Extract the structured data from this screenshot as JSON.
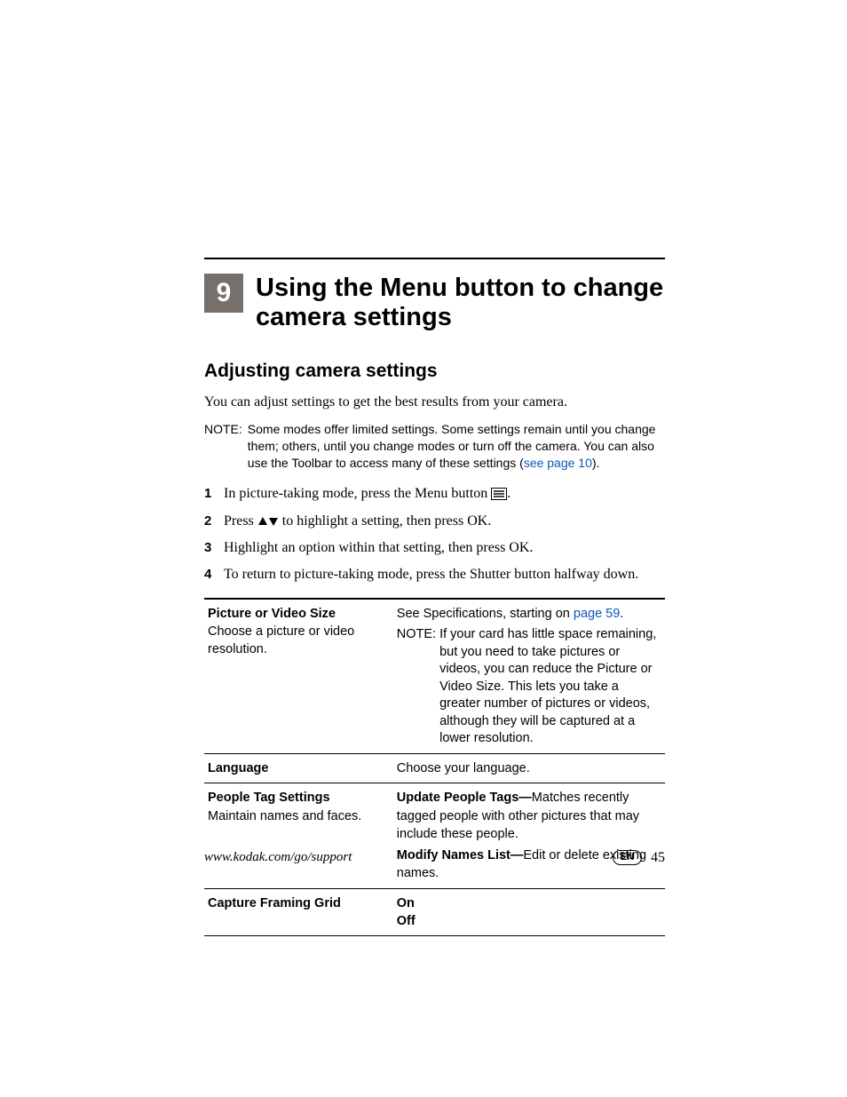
{
  "chapter": {
    "number": "9",
    "title": "Using the Menu button to change camera settings"
  },
  "section": {
    "title": "Adjusting camera settings",
    "intro": "You can adjust settings to get the best results from your camera."
  },
  "note": {
    "label": "NOTE:",
    "body_pre": "Some modes offer limited settings. Some settings remain until you change them; others, until you change modes or turn off the camera. You can also use the Toolbar to access many of these settings (",
    "link": "see page 10",
    "body_post": ")."
  },
  "steps": [
    {
      "num": "1",
      "pre": "In picture-taking mode, press the Menu button ",
      "icon": "menu",
      "post": "."
    },
    {
      "num": "2",
      "pre": "Press ",
      "icon": "updown",
      "post": " to highlight a setting, then press OK."
    },
    {
      "num": "3",
      "pre": "Highlight an option within that setting, then press OK.",
      "icon": "",
      "post": ""
    },
    {
      "num": "4",
      "pre": "To return to picture-taking mode, press the Shutter button halfway down.",
      "icon": "",
      "post": ""
    }
  ],
  "table": {
    "rows": [
      {
        "left_head": "Picture or Video Size",
        "left_sub": "Choose a picture or video resolution.",
        "right_pre": "See Specifications, starting on ",
        "right_link": "page 59",
        "right_post": ".",
        "right_note_label": "NOTE:",
        "right_note": "If your card has little space remaining, but you need to take pictures or videos, you can reduce the Picture or Video Size. This lets you take a greater number of pictures or videos, although they will be captured at a lower resolution."
      },
      {
        "left_head": "Language",
        "left_sub": "",
        "right_text": "Choose your language."
      },
      {
        "left_head": "People Tag Settings",
        "left_sub": "Maintain names and faces.",
        "right_b1": "Update People Tags—",
        "right_t1": "Matches recently tagged people with other pictures that may include these people.",
        "right_b2": "Modify Names List—",
        "right_t2": "Edit or delete existing names."
      },
      {
        "left_head": "Capture Framing Grid",
        "left_sub": "",
        "right_b1": "On",
        "right_b2": "Off"
      }
    ]
  },
  "footer": {
    "url": "www.kodak.com/go/support",
    "lang": "EN",
    "page": "45"
  }
}
